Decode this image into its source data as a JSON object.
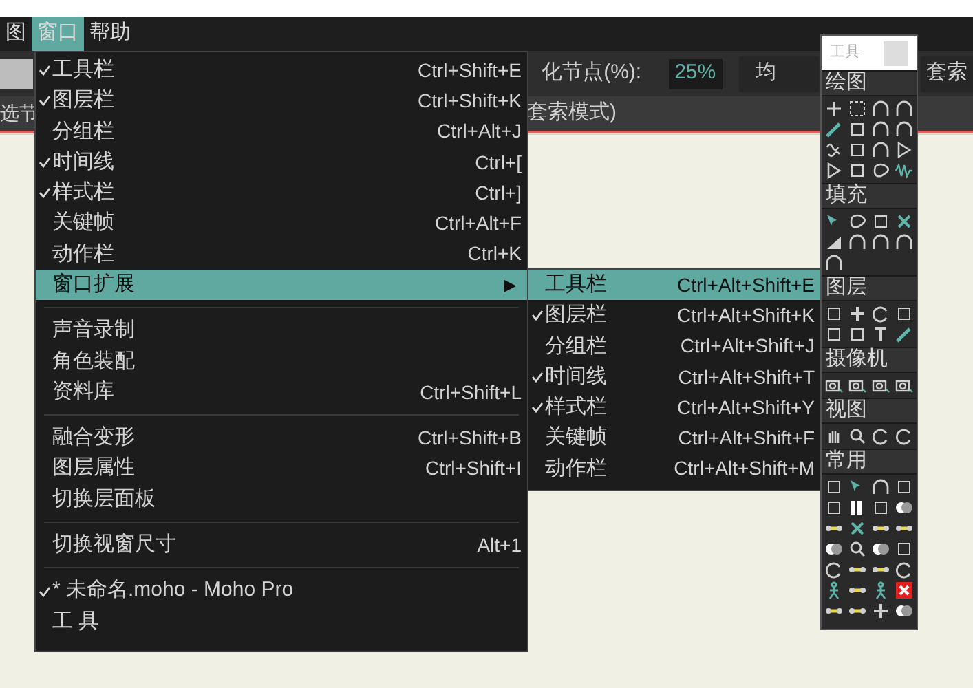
{
  "menubar": [
    {
      "label": "图",
      "selected": false
    },
    {
      "label": "窗口",
      "selected": true
    },
    {
      "label": "帮助",
      "selected": false
    }
  ],
  "toolbar": {
    "simplify_label": "化节点(%):",
    "simplify_value": "25%",
    "split_button": "均",
    "lasso_button": "套索",
    "left_label": "选节",
    "mode_label": "套索模式)"
  },
  "window_menu": [
    {
      "kind": "item",
      "label": "工具栏",
      "shortcut": "Ctrl+Shift+E",
      "checked": true,
      "selected": false
    },
    {
      "kind": "item",
      "label": "图层栏",
      "shortcut": "Ctrl+Shift+K",
      "checked": true,
      "selected": false
    },
    {
      "kind": "item",
      "label": "分组栏",
      "shortcut": "Ctrl+Alt+J",
      "checked": false,
      "selected": false
    },
    {
      "kind": "item",
      "label": "时间线",
      "shortcut": "Ctrl+[",
      "checked": true,
      "selected": false
    },
    {
      "kind": "item",
      "label": "样式栏",
      "shortcut": "Ctrl+]",
      "checked": true,
      "selected": false
    },
    {
      "kind": "item",
      "label": "关键帧",
      "shortcut": "Ctrl+Alt+F",
      "checked": false,
      "selected": false
    },
    {
      "kind": "item",
      "label": "动作栏",
      "shortcut": "Ctrl+K",
      "checked": false,
      "selected": false
    },
    {
      "kind": "submenu",
      "label": "窗口扩展",
      "arrow": "▶",
      "checked": false,
      "selected": true
    },
    {
      "kind": "separator"
    },
    {
      "kind": "item",
      "label": "声音录制",
      "checked": false,
      "selected": false
    },
    {
      "kind": "item",
      "label": "角色装配",
      "checked": false,
      "selected": false
    },
    {
      "kind": "item",
      "label": "资料库",
      "shortcut": "Ctrl+Shift+L",
      "checked": false,
      "selected": false
    },
    {
      "kind": "separator"
    },
    {
      "kind": "item",
      "label": "融合变形",
      "shortcut": "Ctrl+Shift+B",
      "checked": false,
      "selected": false
    },
    {
      "kind": "item",
      "label": "图层属性",
      "shortcut": "Ctrl+Shift+I",
      "checked": false,
      "selected": false
    },
    {
      "kind": "item",
      "label": "切换层面板",
      "checked": false,
      "selected": false
    },
    {
      "kind": "separator"
    },
    {
      "kind": "item",
      "label": "切换视窗尺寸",
      "shortcut": "Alt+1",
      "checked": false,
      "selected": false
    },
    {
      "kind": "separator"
    },
    {
      "kind": "item",
      "label": "* 未命名.moho - Moho Pro",
      "checked": true,
      "selected": false
    },
    {
      "kind": "item",
      "label": "工 具",
      "checked": false,
      "selected": false
    }
  ],
  "extension_menu": [
    {
      "label": "工具栏",
      "shortcut": "Ctrl+Alt+Shift+E",
      "checked": false,
      "selected": true
    },
    {
      "label": "图层栏",
      "shortcut": "Ctrl+Alt+Shift+K",
      "checked": true,
      "selected": false
    },
    {
      "label": "分组栏",
      "shortcut": "Ctrl+Alt+Shift+J",
      "checked": false,
      "selected": false
    },
    {
      "label": "时间线",
      "shortcut": "Ctrl+Alt+Shift+T",
      "checked": true,
      "selected": false
    },
    {
      "label": "样式栏",
      "shortcut": "Ctrl+Alt+Shift+Y",
      "checked": true,
      "selected": false
    },
    {
      "label": "关键帧",
      "shortcut": "Ctrl+Alt+Shift+F",
      "checked": false,
      "selected": false
    },
    {
      "label": "动作栏",
      "shortcut": "Ctrl+Alt+Shift+M",
      "checked": false,
      "selected": false
    }
  ],
  "tools_panel": {
    "title": "工具",
    "sections": [
      {
        "title": "绘图"
      },
      {
        "title": "填充"
      },
      {
        "title": "图层"
      },
      {
        "title": "摄像机"
      },
      {
        "title": "视图"
      },
      {
        "title": "常用"
      }
    ]
  }
}
